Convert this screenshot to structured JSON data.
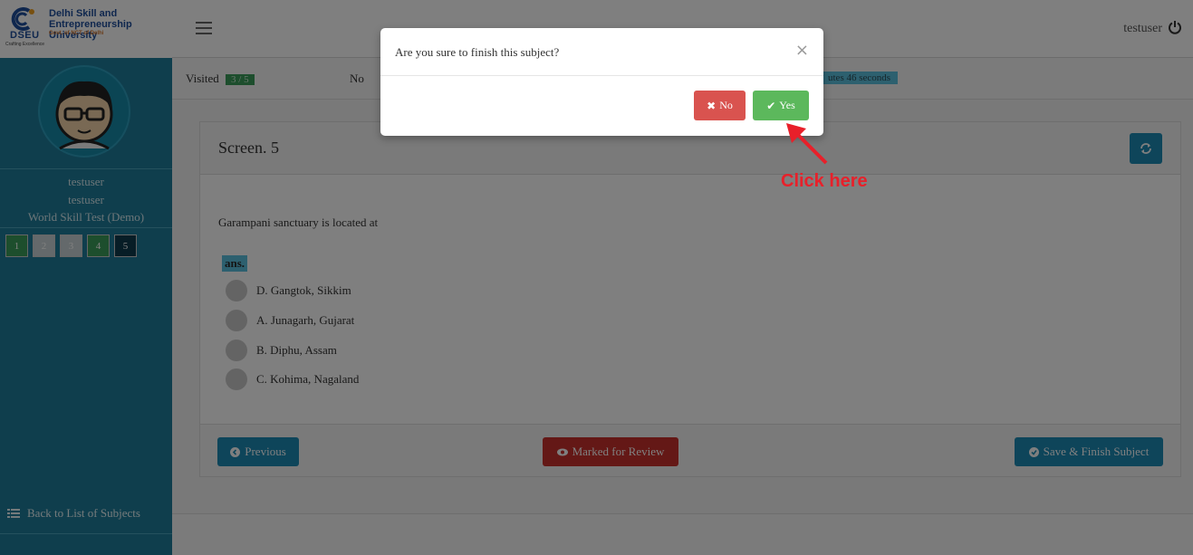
{
  "header": {
    "logo_abbr": "DSEU",
    "logo_name_line1": "Delhi Skill and",
    "logo_name_line2": "Entrepreneurship University",
    "logo_sub": "Govt. of NCT of Delhi",
    "logo_tagline": "Crafting Excellence",
    "username": "testuser",
    "menu_icon": "hamburger-icon",
    "power_icon": "power-icon"
  },
  "sidebar": {
    "name": "testuser",
    "user_id": "testuser",
    "test_name": "World Skill Test (Demo)",
    "questions": [
      {
        "label": "1",
        "status": "answered",
        "color": "#3a9d5a"
      },
      {
        "label": "2",
        "status": "not-visited",
        "color": "#c8d3d6"
      },
      {
        "label": "3",
        "status": "not-visited",
        "color": "#c8d3d6"
      },
      {
        "label": "4",
        "status": "answered",
        "color": "#3a9d5a"
      },
      {
        "label": "5",
        "status": "current",
        "color": "#0f3a4d"
      }
    ],
    "back_label": "Back to List of Subjects"
  },
  "status": {
    "visited_label": "Visited",
    "visited_value": "3 / 5",
    "not_label": "No",
    "timer_text": "utes 46 seconds"
  },
  "question": {
    "title": "Screen. 5",
    "text": "Garampani sanctuary is located at",
    "ans_label": "ans.",
    "options": [
      "D. Gangtok, Sikkim",
      "A. Junagarh, Gujarat",
      "B. Diphu, Assam",
      "C. Kohima, Nagaland"
    ]
  },
  "footer": {
    "previous_label": "Previous",
    "review_label": "Marked for Review",
    "finish_label": "Save & Finish Subject"
  },
  "modal": {
    "title": "Are you sure to finish this subject?",
    "close": "×",
    "no_label": "No",
    "yes_label": "Yes"
  },
  "annotation": {
    "text": "Click here",
    "color": "#e8202a"
  }
}
